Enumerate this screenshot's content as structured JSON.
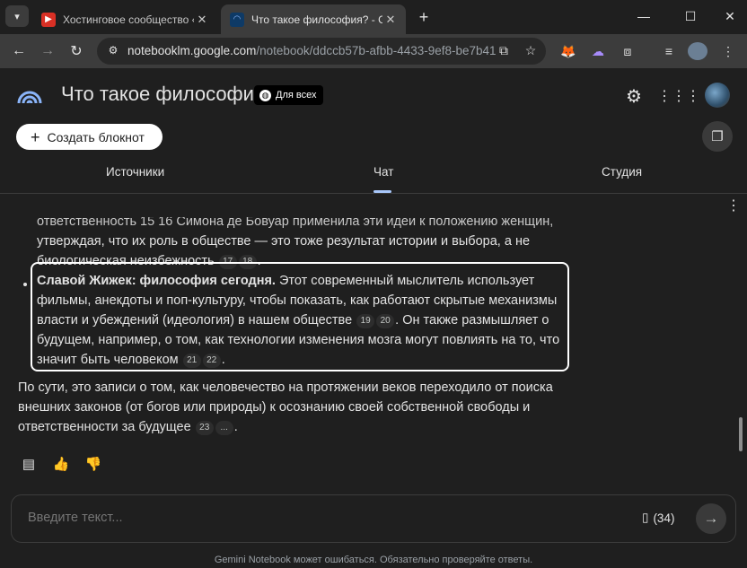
{
  "browser": {
    "tabs": [
      {
        "title": "Хостинговое сообщество «Tim",
        "favicon": "youtube-icon",
        "active": false
      },
      {
        "title": "Что такое философия? - Gemin",
        "favicon": "notebooklm-icon",
        "active": true
      }
    ],
    "url_host": "notebooklm.google.com",
    "url_path": "/notebook/ddccb57b-afbb-4433-9ef8-be7b41..."
  },
  "app": {
    "title": "Что такое философия?",
    "share_label": "Для всех",
    "create_label": "Создать блокнот",
    "tabs": {
      "sources": "Источники",
      "chat": "Чат",
      "studio": "Студия"
    },
    "accent_color": "#a8c7fa"
  },
  "chat": {
    "prev_line1": "ответственность 15 16 Симона де Бовуар применила эти идеи к положению женщин,",
    "prev_line2": "утверждая, что их роль в обществе — это тоже результат истории и выбора, а не",
    "prev_line3": "биологическая неизбежность",
    "prev_cites": [
      "17",
      "18"
    ],
    "bullet_bold": "Славой Жижек: философия сегодня.",
    "bullet_text_a": " Этот современный мыслитель использует фильмы, анекдоты и поп-культуру, чтобы показать, как работают скрытые механизмы власти и убеждений (идеология) в нашем обществе",
    "bullet_cites_a": [
      "19",
      "20"
    ],
    "bullet_text_b": ". Он также размышляет о будущем, например, о том, как технологии изменения мозга могут повлиять на то, что значит быть человеком",
    "bullet_cites_b": [
      "21",
      "22"
    ],
    "summary_text": "По сути, это записи о том, как человечество на протяжении веков переходило от поиска внешних законов (от богов или природы) к осознанию своей собственной свободы и ответственности за будущее",
    "summary_cites": [
      "23",
      "..."
    ]
  },
  "composer": {
    "placeholder": "Введите текст...",
    "source_count": "(34)"
  },
  "footer": "Gemini Notebook может ошибаться. Обязательно проверяйте ответы."
}
